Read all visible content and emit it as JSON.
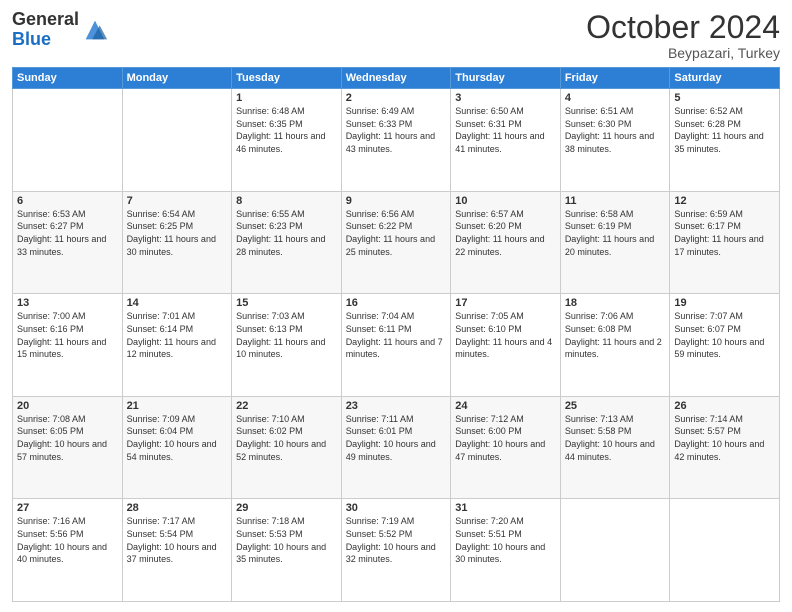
{
  "logo": {
    "general": "General",
    "blue": "Blue"
  },
  "header": {
    "month": "October 2024",
    "location": "Beypazari, Turkey"
  },
  "days_of_week": [
    "Sunday",
    "Monday",
    "Tuesday",
    "Wednesday",
    "Thursday",
    "Friday",
    "Saturday"
  ],
  "weeks": [
    [
      {
        "day": "",
        "info": ""
      },
      {
        "day": "",
        "info": ""
      },
      {
        "day": "1",
        "info": "Sunrise: 6:48 AM\nSunset: 6:35 PM\nDaylight: 11 hours and 46 minutes."
      },
      {
        "day": "2",
        "info": "Sunrise: 6:49 AM\nSunset: 6:33 PM\nDaylight: 11 hours and 43 minutes."
      },
      {
        "day": "3",
        "info": "Sunrise: 6:50 AM\nSunset: 6:31 PM\nDaylight: 11 hours and 41 minutes."
      },
      {
        "day": "4",
        "info": "Sunrise: 6:51 AM\nSunset: 6:30 PM\nDaylight: 11 hours and 38 minutes."
      },
      {
        "day": "5",
        "info": "Sunrise: 6:52 AM\nSunset: 6:28 PM\nDaylight: 11 hours and 35 minutes."
      }
    ],
    [
      {
        "day": "6",
        "info": "Sunrise: 6:53 AM\nSunset: 6:27 PM\nDaylight: 11 hours and 33 minutes."
      },
      {
        "day": "7",
        "info": "Sunrise: 6:54 AM\nSunset: 6:25 PM\nDaylight: 11 hours and 30 minutes."
      },
      {
        "day": "8",
        "info": "Sunrise: 6:55 AM\nSunset: 6:23 PM\nDaylight: 11 hours and 28 minutes."
      },
      {
        "day": "9",
        "info": "Sunrise: 6:56 AM\nSunset: 6:22 PM\nDaylight: 11 hours and 25 minutes."
      },
      {
        "day": "10",
        "info": "Sunrise: 6:57 AM\nSunset: 6:20 PM\nDaylight: 11 hours and 22 minutes."
      },
      {
        "day": "11",
        "info": "Sunrise: 6:58 AM\nSunset: 6:19 PM\nDaylight: 11 hours and 20 minutes."
      },
      {
        "day": "12",
        "info": "Sunrise: 6:59 AM\nSunset: 6:17 PM\nDaylight: 11 hours and 17 minutes."
      }
    ],
    [
      {
        "day": "13",
        "info": "Sunrise: 7:00 AM\nSunset: 6:16 PM\nDaylight: 11 hours and 15 minutes."
      },
      {
        "day": "14",
        "info": "Sunrise: 7:01 AM\nSunset: 6:14 PM\nDaylight: 11 hours and 12 minutes."
      },
      {
        "day": "15",
        "info": "Sunrise: 7:03 AM\nSunset: 6:13 PM\nDaylight: 11 hours and 10 minutes."
      },
      {
        "day": "16",
        "info": "Sunrise: 7:04 AM\nSunset: 6:11 PM\nDaylight: 11 hours and 7 minutes."
      },
      {
        "day": "17",
        "info": "Sunrise: 7:05 AM\nSunset: 6:10 PM\nDaylight: 11 hours and 4 minutes."
      },
      {
        "day": "18",
        "info": "Sunrise: 7:06 AM\nSunset: 6:08 PM\nDaylight: 11 hours and 2 minutes."
      },
      {
        "day": "19",
        "info": "Sunrise: 7:07 AM\nSunset: 6:07 PM\nDaylight: 10 hours and 59 minutes."
      }
    ],
    [
      {
        "day": "20",
        "info": "Sunrise: 7:08 AM\nSunset: 6:05 PM\nDaylight: 10 hours and 57 minutes."
      },
      {
        "day": "21",
        "info": "Sunrise: 7:09 AM\nSunset: 6:04 PM\nDaylight: 10 hours and 54 minutes."
      },
      {
        "day": "22",
        "info": "Sunrise: 7:10 AM\nSunset: 6:02 PM\nDaylight: 10 hours and 52 minutes."
      },
      {
        "day": "23",
        "info": "Sunrise: 7:11 AM\nSunset: 6:01 PM\nDaylight: 10 hours and 49 minutes."
      },
      {
        "day": "24",
        "info": "Sunrise: 7:12 AM\nSunset: 6:00 PM\nDaylight: 10 hours and 47 minutes."
      },
      {
        "day": "25",
        "info": "Sunrise: 7:13 AM\nSunset: 5:58 PM\nDaylight: 10 hours and 44 minutes."
      },
      {
        "day": "26",
        "info": "Sunrise: 7:14 AM\nSunset: 5:57 PM\nDaylight: 10 hours and 42 minutes."
      }
    ],
    [
      {
        "day": "27",
        "info": "Sunrise: 7:16 AM\nSunset: 5:56 PM\nDaylight: 10 hours and 40 minutes."
      },
      {
        "day": "28",
        "info": "Sunrise: 7:17 AM\nSunset: 5:54 PM\nDaylight: 10 hours and 37 minutes."
      },
      {
        "day": "29",
        "info": "Sunrise: 7:18 AM\nSunset: 5:53 PM\nDaylight: 10 hours and 35 minutes."
      },
      {
        "day": "30",
        "info": "Sunrise: 7:19 AM\nSunset: 5:52 PM\nDaylight: 10 hours and 32 minutes."
      },
      {
        "day": "31",
        "info": "Sunrise: 7:20 AM\nSunset: 5:51 PM\nDaylight: 10 hours and 30 minutes."
      },
      {
        "day": "",
        "info": ""
      },
      {
        "day": "",
        "info": ""
      }
    ]
  ]
}
